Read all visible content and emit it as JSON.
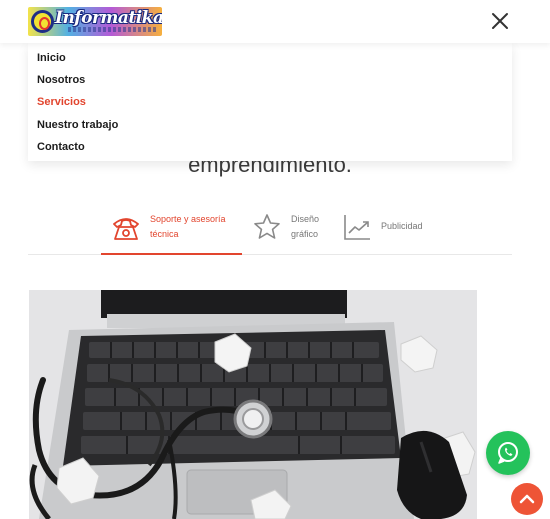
{
  "brand": {
    "logo_text": "Informatika"
  },
  "nav": {
    "items": [
      {
        "label": "Inicio",
        "active": false
      },
      {
        "label": "Nosotros",
        "active": false
      },
      {
        "label": "Servicios",
        "active": true
      },
      {
        "label": "Nuestro trabajo",
        "active": false
      },
      {
        "label": "Contacto",
        "active": false
      }
    ],
    "close_icon": "close-icon"
  },
  "hero": {
    "text": "emprendimiento."
  },
  "tabs": [
    {
      "line1": "Soporte y asesoría",
      "line2": "técnica",
      "icon": "telephone-icon",
      "active": true
    },
    {
      "line1": "Diseño",
      "line2": "gráfico",
      "icon": "star-icon",
      "active": false
    },
    {
      "line1": "Publicidad",
      "line2": "",
      "icon": "chart-growth-icon",
      "active": false
    }
  ],
  "photo": {
    "subject": "laptop-stethoscope-image"
  },
  "floating": {
    "whatsapp_icon": "whatsapp-icon",
    "back_to_top_icon": "chevron-up-icon"
  },
  "colors": {
    "accent": "#e2452e",
    "whatsapp": "#24c25b",
    "back_to_top": "#ee5436"
  }
}
